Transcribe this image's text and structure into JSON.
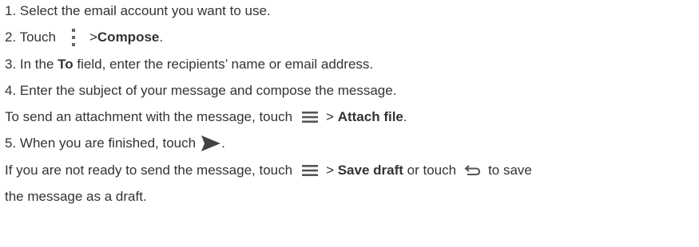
{
  "steps": {
    "s1": "1. Select the email account you want to use.",
    "s2_pre": "2. Touch",
    "s2_gt": ">",
    "s2_bold": "Compose",
    "s2_end": ".",
    "s3_pre": "3. In the ",
    "s3_bold": "To",
    "s3_post": " field, enter the recipients’ name or email address.",
    "s4": "4. Enter the subject of your message and compose the message.",
    "attach_pre": "To send an attachment with the message, touch",
    "attach_gt": "> ",
    "attach_bold": "Attach file",
    "attach_end": ".",
    "s5_pre": "5. When you are finished, touch",
    "s5_end": ".",
    "draft_pre": "If you are not ready to send the message, touch",
    "draft_gt": "> ",
    "draft_bold": "Save draft",
    "draft_mid": " or touch",
    "draft_post": "to save",
    "draft_line2": "the message as a draft."
  },
  "icons": {
    "overflow": "overflow-menu-icon",
    "menu": "menu-icon",
    "send": "send-icon",
    "back": "back-icon"
  }
}
